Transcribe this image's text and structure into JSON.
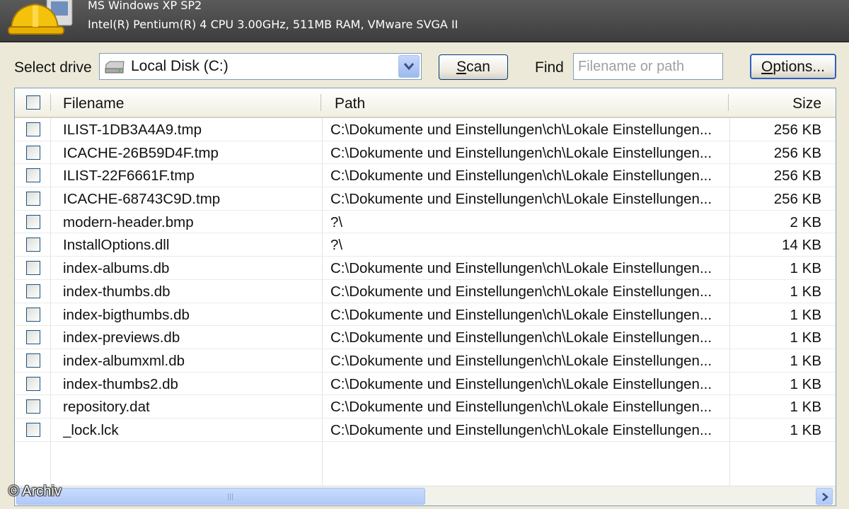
{
  "header": {
    "line1": "MS Windows XP SP2",
    "line2": "Intel(R) Pentium(R) 4 CPU 3.00GHz, 511MB RAM, VMware SVGA II"
  },
  "toolbar": {
    "select_drive_label": "Select drive",
    "drive_value": "Local Disk (C:)",
    "scan_label": "Scan",
    "find_label": "Find",
    "find_placeholder": "Filename or path",
    "options_label": "Options..."
  },
  "table": {
    "columns": [
      "Filename",
      "Path",
      "Size"
    ],
    "rows": [
      {
        "name": "ILIST-1DB3A4A9.tmp",
        "path": "C:\\Dokumente und Einstellungen\\ch\\Lokale Einstellungen...",
        "size": "256 KB"
      },
      {
        "name": "ICACHE-26B59D4F.tmp",
        "path": "C:\\Dokumente und Einstellungen\\ch\\Lokale Einstellungen...",
        "size": "256 KB"
      },
      {
        "name": "ILIST-22F6661F.tmp",
        "path": "C:\\Dokumente und Einstellungen\\ch\\Lokale Einstellungen...",
        "size": "256 KB"
      },
      {
        "name": "ICACHE-68743C9D.tmp",
        "path": "C:\\Dokumente und Einstellungen\\ch\\Lokale Einstellungen...",
        "size": "256 KB"
      },
      {
        "name": "modern-header.bmp",
        "path": "?\\",
        "size": "2 KB"
      },
      {
        "name": "InstallOptions.dll",
        "path": "?\\",
        "size": "14 KB"
      },
      {
        "name": "index-albums.db",
        "path": "C:\\Dokumente und Einstellungen\\ch\\Lokale Einstellungen...",
        "size": "1 KB"
      },
      {
        "name": "index-thumbs.db",
        "path": "C:\\Dokumente und Einstellungen\\ch\\Lokale Einstellungen...",
        "size": "1 KB"
      },
      {
        "name": "index-bigthumbs.db",
        "path": "C:\\Dokumente und Einstellungen\\ch\\Lokale Einstellungen...",
        "size": "1 KB"
      },
      {
        "name": "index-previews.db",
        "path": "C:\\Dokumente und Einstellungen\\ch\\Lokale Einstellungen...",
        "size": "1 KB"
      },
      {
        "name": "index-albumxml.db",
        "path": "C:\\Dokumente und Einstellungen\\ch\\Lokale Einstellungen...",
        "size": "1 KB"
      },
      {
        "name": "index-thumbs2.db",
        "path": "C:\\Dokumente und Einstellungen\\ch\\Lokale Einstellungen...",
        "size": "1 KB"
      },
      {
        "name": "repository.dat",
        "path": "C:\\Dokumente und Einstellungen\\ch\\Lokale Einstellungen...",
        "size": "1 KB"
      },
      {
        "name": "_lock.lck",
        "path": "C:\\Dokumente und Einstellungen\\ch\\Lokale Einstellungen...",
        "size": "1 KB"
      }
    ]
  },
  "watermark": "© Archiv",
  "icons": {
    "logo": "hardhat-computer-icon",
    "drive": "hard-drive-icon",
    "dropdown": "chevron-down-icon",
    "scroll_right": "chevron-right-icon"
  },
  "colors": {
    "header_bg": "#4a4a4a",
    "window_bg": "#ece9d8",
    "border": "#7f9db9",
    "scroll_accent": "#b1c9f7"
  }
}
